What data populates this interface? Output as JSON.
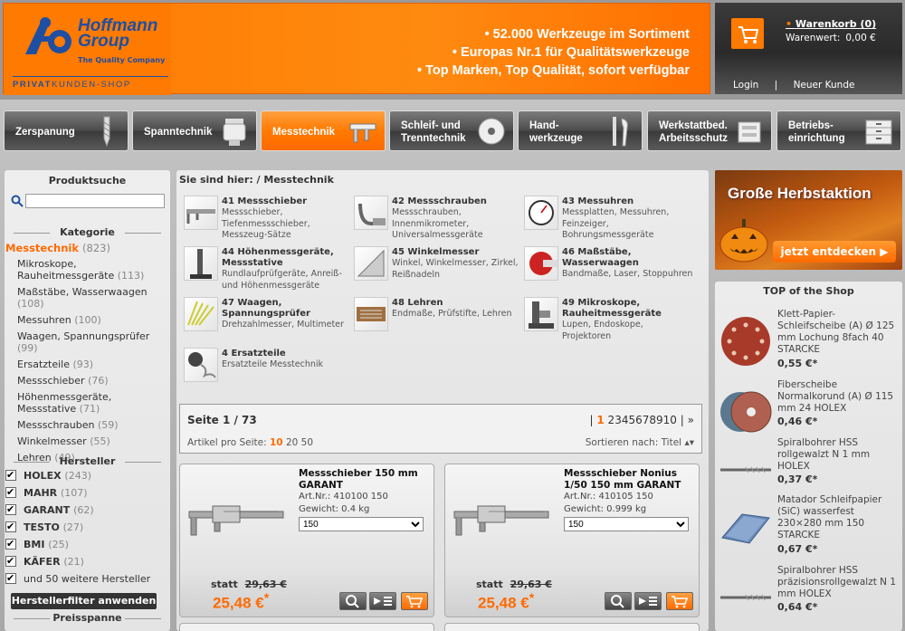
{
  "header": {
    "logo_line1": "Hoffmann",
    "logo_line2": "Group",
    "logo_tag": "The Quality Company",
    "shop_label_bold": "PRIVAT",
    "shop_label_rest": "KUNDEN-SHOP",
    "usps": [
      "52.000 Werkzeuge im Sortiment",
      "Europas Nr.1 für Qualitätswerkzeuge",
      "Top Marken, Top Qualität, sofort verfügbar"
    ],
    "cart_title": "Warenkorb (0)",
    "cart_value_label": "Warenwert:",
    "cart_value": "0,00 €",
    "login": "Login",
    "separator": "|",
    "new_customer": "Neuer Kunde"
  },
  "nav": [
    {
      "label": "Zerspanung",
      "icon": "drill-bit-icon"
    },
    {
      "label": "Spanntechnik",
      "icon": "chuck-icon"
    },
    {
      "label": "Messtechnik",
      "icon": "caliper-icon",
      "active": true
    },
    {
      "label": "Schleif- und Trenntechnik",
      "icon": "grinding-disc-icon"
    },
    {
      "label": "Hand- werkzeuge",
      "icon": "hand-tools-icon"
    },
    {
      "label": "Werkstattbed. Arbeitsschutz",
      "icon": "workshop-icon"
    },
    {
      "label": "Betriebs- einrichtung",
      "icon": "cabinet-icon"
    }
  ],
  "sidebar": {
    "product_search": "Produktsuche",
    "search_placeholder": "",
    "category_title": "Kategorie",
    "category_top": {
      "label": "Messtechnik",
      "count": "(823)"
    },
    "categories": [
      {
        "label": "Mikroskope, Rauheitmessgeräte",
        "count": "(113)"
      },
      {
        "label": "Maßstäbe, Wasserwaagen",
        "count": "(108)"
      },
      {
        "label": "Messuhren",
        "count": "(100)"
      },
      {
        "label": "Waagen, Spannungsprüfer",
        "count": "(99)"
      },
      {
        "label": "Ersatzteile",
        "count": "(93)"
      },
      {
        "label": "Messschieber",
        "count": "(76)"
      },
      {
        "label": "Höhenmessgeräte, Messstative",
        "count": "(71)"
      },
      {
        "label": "Messschrauben",
        "count": "(59)"
      },
      {
        "label": "Winkelmesser",
        "count": "(55)"
      },
      {
        "label": "Lehren",
        "count": "(49)"
      }
    ],
    "manufacturer_title": "Hersteller",
    "manufacturers": [
      {
        "label": "HOLEX",
        "count": "(243)"
      },
      {
        "label": "MAHR",
        "count": "(107)"
      },
      {
        "label": "GARANT",
        "count": "(62)"
      },
      {
        "label": "TESTO",
        "count": "(27)"
      },
      {
        "label": "BMI",
        "count": "(25)"
      },
      {
        "label": "KÄFER",
        "count": "(21)"
      }
    ],
    "more_manufacturers": "und 50 weitere Hersteller",
    "filter_button": "Herstellerfilter anwenden",
    "price_title": "Preisspanne"
  },
  "main": {
    "breadcrumb": "Sie sind hier: / Messtechnik",
    "subcategories": [
      {
        "title": "41 Messschieber",
        "desc": "Messschieber, Tiefenmessschieber, Messzeug-Sätze"
      },
      {
        "title": "42 Messschrauben",
        "desc": "Messschrauben, Innenmikrometer, Universalmessgeräte"
      },
      {
        "title": "43 Messuhren",
        "desc": "Messplatten, Messuhren, Feinzeiger, Bohrungsmessgeräte"
      },
      {
        "title": "44 Höhenmessgeräte, Messstative",
        "desc": "Rundlaufprüfgeräte, Anreiß- und Höhenmessgeräte"
      },
      {
        "title": "45 Winkelmesser",
        "desc": "Winkel, Winkelmesser, Zirkel, Reißnadeln"
      },
      {
        "title": "46 Maßstäbe, Wasserwaagen",
        "desc": "Bandmaße, Laser, Stoppuhren"
      },
      {
        "title": "47 Waagen, Spannungsprüfer",
        "desc": "Drehzahlmesser, Multimeter"
      },
      {
        "title": "48 Lehren",
        "desc": "Endmaße, Prüfstifte, Lehren"
      },
      {
        "title": "49 Mikroskope, Rauheitmessgeräte",
        "desc": "Lupen, Endoskope, Projektoren"
      },
      {
        "title": "4 Ersatzteile",
        "desc": "Ersatzteile Messtechnik"
      }
    ],
    "pager": {
      "page_info": "Seite 1 / 73",
      "sep": "|",
      "current": "1",
      "pages": [
        "2",
        "3",
        "4",
        "5",
        "6",
        "7",
        "8",
        "9",
        "10"
      ],
      "next": "»",
      "per_page_label": "Artikel pro Seite:",
      "per_page_options": [
        "10",
        "20",
        "50"
      ],
      "sort_label": "Sortieren nach:",
      "sort_value": "Titel"
    },
    "products": [
      {
        "name": "Messschieber 150 mm GARANT",
        "art": "Art.Nr.: 410100 150",
        "weight": "Gewicht: 0.4 kg",
        "variant": "150",
        "statt_label": "statt",
        "old_price": "29,63 €",
        "price": "25,48 €",
        "price_mark": "*"
      },
      {
        "name": "Messschieber Nonius 1/50 150 mm GARANT",
        "art": "Art.Nr.: 410105 150",
        "weight": "Gewicht: 0.999 kg",
        "variant": "150",
        "statt_label": "statt",
        "old_price": "29,63 €",
        "price": "25,48 €",
        "price_mark": "*"
      }
    ]
  },
  "promo": {
    "title": "Große Herbstaktion",
    "button": "jetzt entdecken",
    "button_arrow": "▶"
  },
  "top_shop": {
    "title": "TOP of the Shop",
    "items": [
      {
        "name": "Klett-Papier-Schleifscheibe (A) Ø 125 mm Lochung 8fach 40 STARCKE",
        "price": "0,55 €*"
      },
      {
        "name": "Fiberscheibe Normalkorund (A) Ø 115 mm 24 HOLEX",
        "price": "0,46 €*"
      },
      {
        "name": "Spiralbohrer HSS rollgewalzt N 1 mm HOLEX",
        "price": "0,37 €*"
      },
      {
        "name": "Matador Schleifpapier (SiC) wasserfest 230×280 mm 150 STARCKE",
        "price": "0,67 €*"
      },
      {
        "name": "Spiralbohrer HSS präzisionsrollgewalzt N 1 mm HOLEX",
        "price": "0,64 €*"
      }
    ]
  },
  "colors": {
    "accent": "#ff7a00",
    "brand_blue": "#1f4fa2",
    "dark": "#333333"
  }
}
